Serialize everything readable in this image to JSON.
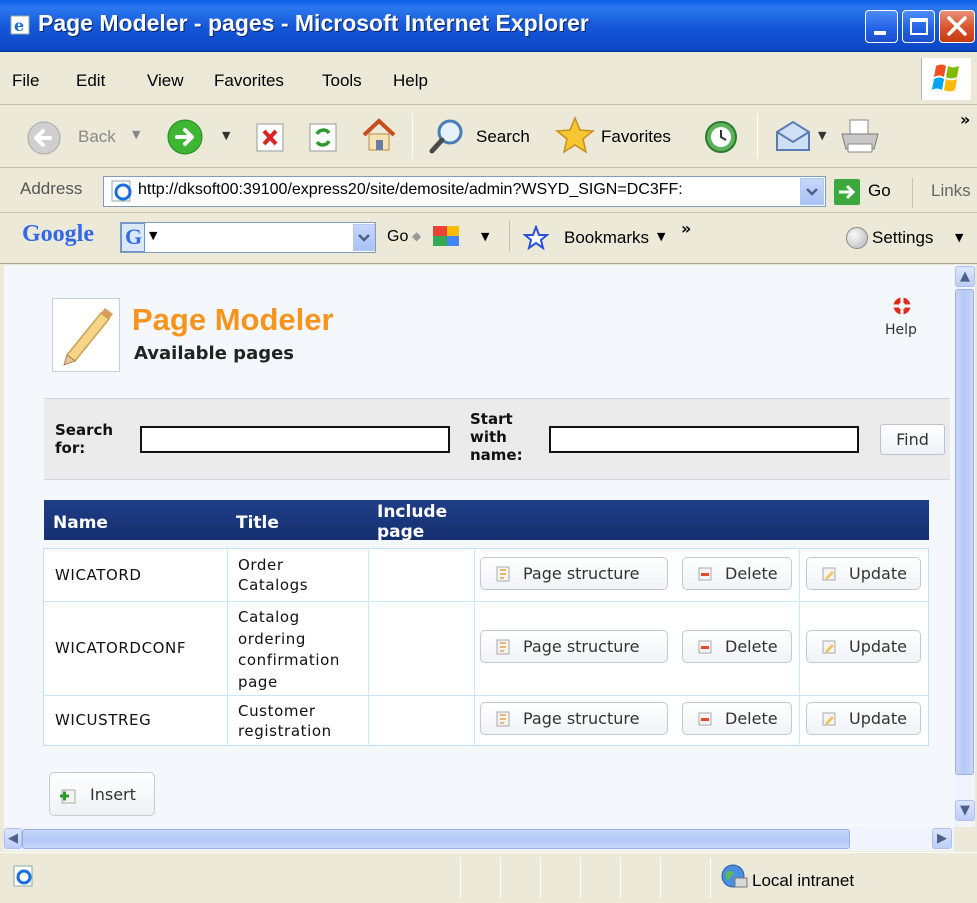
{
  "window": {
    "title": "Page Modeler - pages - Microsoft Internet Explorer"
  },
  "menubar": {
    "items": [
      "File",
      "Edit",
      "View",
      "Favorites",
      "Tools",
      "Help"
    ]
  },
  "toolbar": {
    "back_label": "Back",
    "search_label": "Search",
    "favorites_label": "Favorites",
    "overflow": "»"
  },
  "addressbar": {
    "label": "Address",
    "url": "http://dksoft00:39100/express20/site/demosite/admin?WSYD_SIGN=DC3FF:",
    "go_label": "Go",
    "links_label": "Links"
  },
  "googlebar": {
    "logo": "Google",
    "go_label": "Go",
    "bookmarks_label": "Bookmarks",
    "overflow": "»",
    "settings_label": "Settings"
  },
  "page": {
    "title": "Page Modeler",
    "subtitle": "Available pages",
    "help_label": "Help",
    "search": {
      "search_for_label_1": "Search",
      "search_for_label_2": "for:",
      "start_label_1": "Start",
      "start_label_2": "with",
      "start_label_3": "name:",
      "search_for_value": "",
      "start_with_value": "",
      "find_label": "Find"
    },
    "table": {
      "headers": [
        "Name",
        "Title",
        "Include",
        "page"
      ],
      "rows": [
        {
          "name": "WICATORD",
          "title_lines": [
            "Order",
            "Catalogs"
          ],
          "include": "",
          "structure_label": "Page structure",
          "delete_label": "Delete",
          "update_label": "Update"
        },
        {
          "name": "WICATORDCONF",
          "title_lines": [
            "Catalog",
            "ordering",
            "confirmation",
            "page"
          ],
          "include": "",
          "structure_label": "Page structure",
          "delete_label": "Delete",
          "update_label": "Update"
        },
        {
          "name": "WICUSTREG",
          "title_lines": [
            "Customer",
            "registration"
          ],
          "include": "",
          "structure_label": "Page structure",
          "delete_label": "Delete",
          "update_label": "Update"
        }
      ]
    },
    "insert_label": "Insert"
  },
  "statusbar": {
    "zone": "Local intranet"
  },
  "colors": {
    "title_orange": "#f7941d",
    "table_header": "#1f3e88",
    "xp_blue": "#0a5fe6"
  }
}
